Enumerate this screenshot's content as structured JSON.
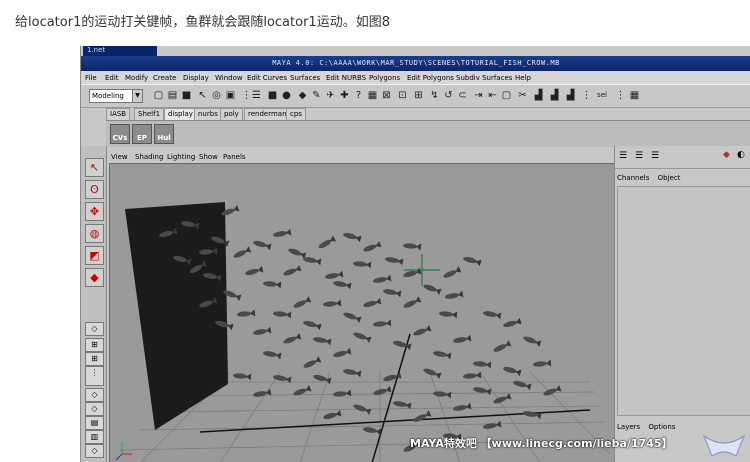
{
  "caption": "给locator1的运动打关键帧，鱼群就会跟随locator1运动。如图8",
  "window": {
    "mini_title": "1.net",
    "title": "MAYA 4.0: C:\\AAAA\\WORK\\MAR_STUDY\\SCENES\\TOTURIAL_FISH_CROW.MB"
  },
  "menus": [
    "File",
    "Edit",
    "Modify",
    "Create",
    "Display",
    "Window",
    "Edit Curves",
    "Surfaces",
    "Edit NURBS",
    "Polygons",
    "Edit Polygons",
    "Subdiv Surfaces",
    "Help"
  ],
  "toolbar": {
    "mode": "Modeling",
    "sel_label": "sel"
  },
  "shelf_tabs": [
    "IASB",
    "Shelf1",
    "display",
    "nurbs",
    "poly",
    "renderman",
    "cps"
  ],
  "shelf_buttons": [
    "CVs",
    "EP",
    "Hul"
  ],
  "viewport_menus": [
    "View",
    "Shading",
    "Lighting",
    "Show",
    "Panels"
  ],
  "channel_box": {
    "tabs": [
      "Channels",
      "Object"
    ],
    "layer_tabs": [
      "Layers",
      "Options"
    ]
  },
  "watermark": "MAYA特效吧 【www.linecg.com/lieba/1745】",
  "colors": {
    "title_bar": "#0a246a",
    "viewport": "#9a9a9a",
    "locator": "#1f7a4a"
  }
}
